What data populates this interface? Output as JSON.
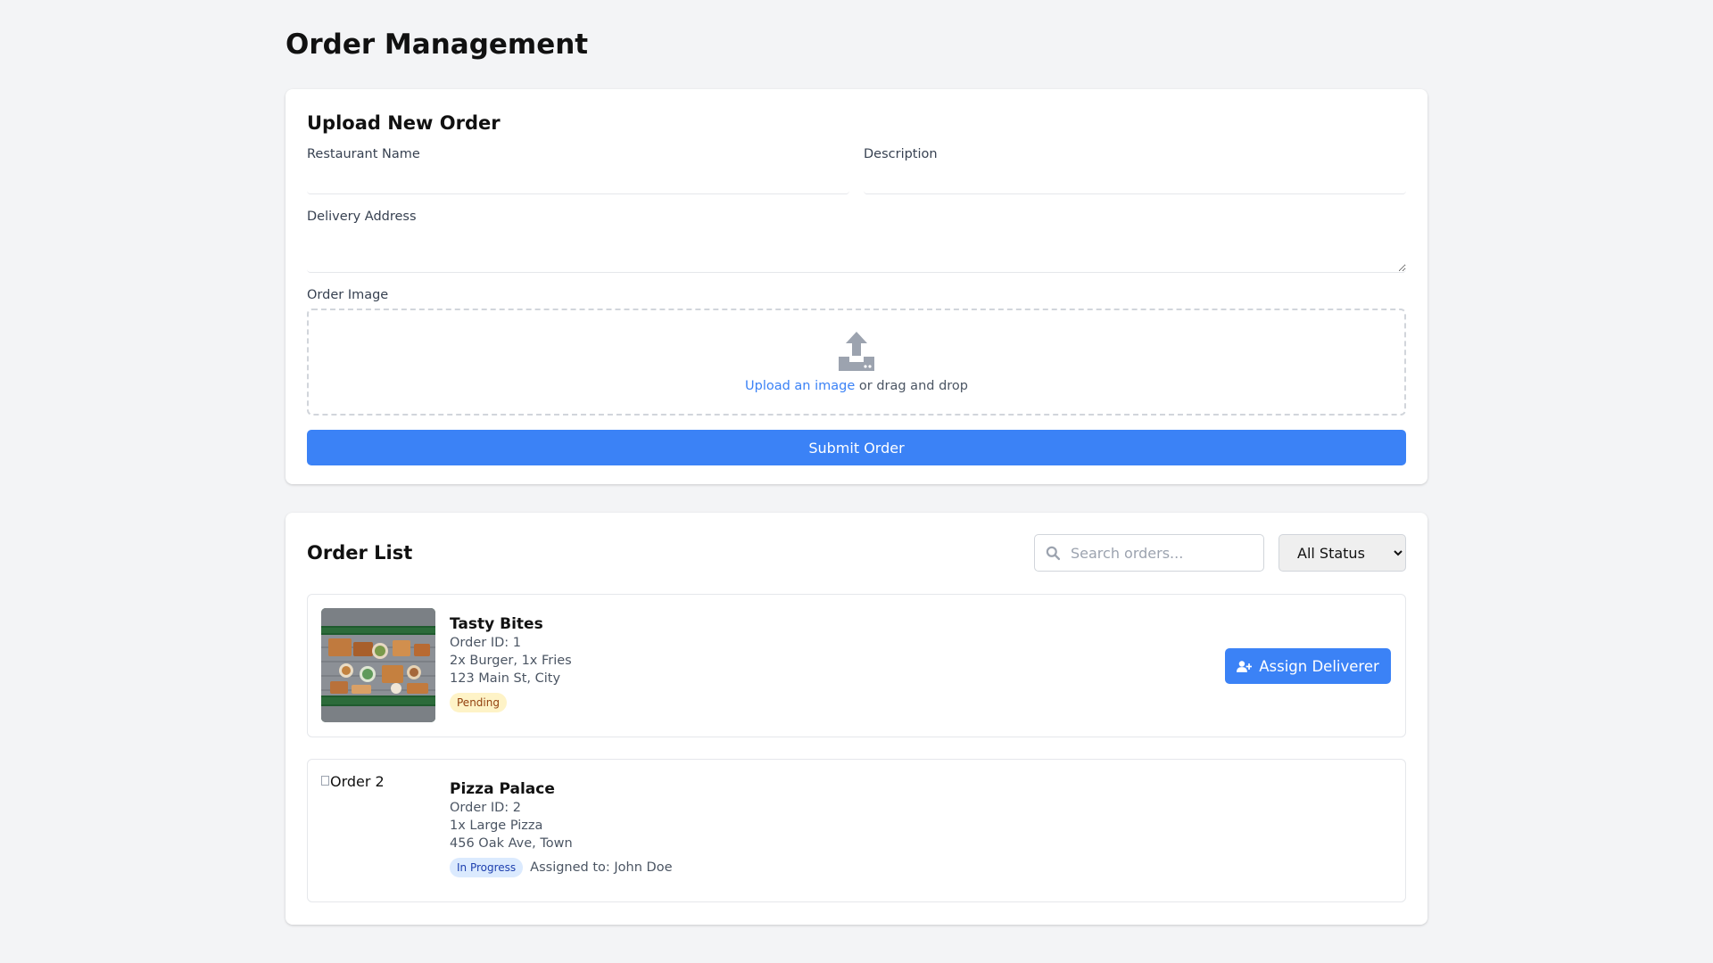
{
  "page": {
    "title": "Order Management"
  },
  "upload_form": {
    "title": "Upload New Order",
    "restaurant_label": "Restaurant Name",
    "restaurant_value": "",
    "description_label": "Description",
    "description_value": "",
    "address_label": "Delivery Address",
    "address_value": "",
    "image_label": "Order Image",
    "upload_link": "Upload an image",
    "upload_hint": " or drag and drop",
    "submit_label": "Submit Order"
  },
  "order_list": {
    "title": "Order List",
    "search_placeholder": "Search orders...",
    "status_filter": "All Status",
    "orders": [
      {
        "restaurant": "Tasty Bites",
        "order_id": "Order ID: 1",
        "items": "2x Burger, 1x Fries",
        "address": "123 Main St, City",
        "status": "Pending",
        "action": "Assign Deliverer"
      },
      {
        "restaurant": "Pizza Palace",
        "image_alt": "Order 2",
        "order_id": "Order ID: 2",
        "items": "1x Large Pizza",
        "address": "456 Oak Ave, Town",
        "status": "In Progress",
        "assigned": "Assigned to: John Doe"
      }
    ]
  },
  "colors": {
    "accent": "#3b82f6",
    "page_bg": "#f3f4f6",
    "pending_bg": "#fef3c7",
    "progress_bg": "#dbeafe"
  }
}
